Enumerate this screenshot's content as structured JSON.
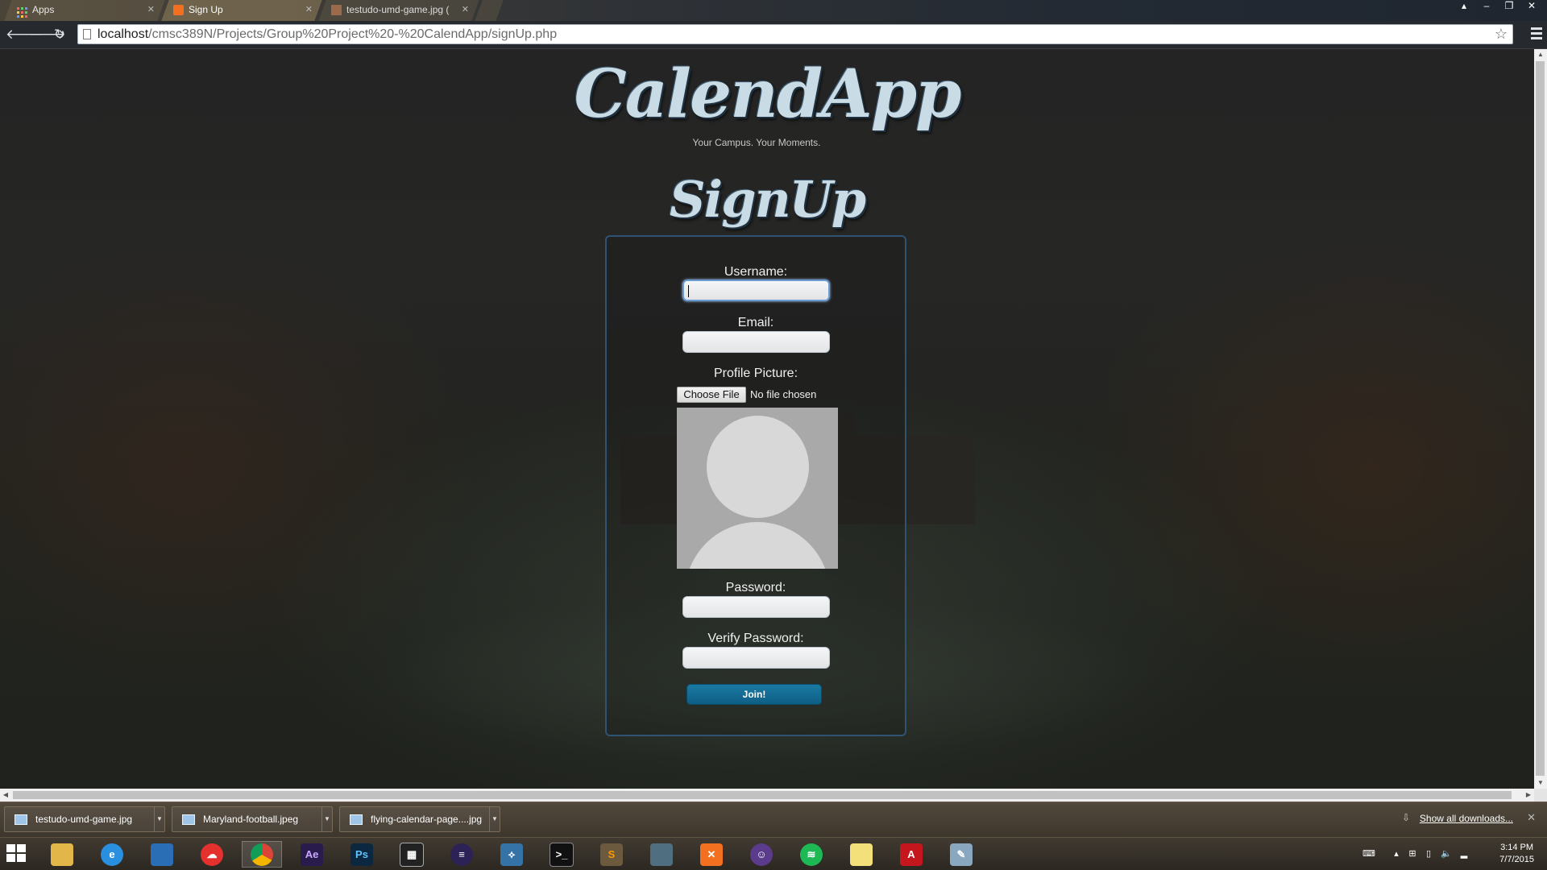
{
  "browser": {
    "tabs": [
      {
        "label": "Apps",
        "active": false
      },
      {
        "label": "Sign Up",
        "active": true
      },
      {
        "label": "testudo-umd-game.jpg (",
        "active": false
      }
    ],
    "url_host": "localhost",
    "url_path": "/cmsc389N/Projects/Group%20Project%20-%20CalendApp/signUp.php"
  },
  "page": {
    "logo": "CalendApp",
    "tagline": "Your Campus. Your Moments.",
    "title": "SignUp",
    "form": {
      "username_label": "Username:",
      "username_value": "",
      "email_label": "Email:",
      "email_value": "",
      "profile_label": "Profile Picture:",
      "choose_file": "Choose File",
      "file_status": "No file chosen",
      "password_label": "Password:",
      "verify_label": "Verify Password:",
      "join_label": "Join!"
    }
  },
  "downloads": {
    "items": [
      "testudo-umd-game.jpg",
      "Maryland-football.jpeg",
      "flying-calendar-page....jpg"
    ],
    "show_all": "Show all downloads..."
  },
  "taskbar": {
    "apps": [
      "file-explorer",
      "internet-explorer",
      "remote-desktop",
      "cloud-app",
      "chrome",
      "after-effects",
      "photoshop",
      "media-player",
      "eclipse",
      "python",
      "terminal",
      "sublime-text",
      "network-app",
      "xampp",
      "github",
      "spotify",
      "sticky-notes",
      "acrobat",
      "paint"
    ],
    "time": "3:14 PM",
    "date": "7/7/2015"
  },
  "colors": {
    "join_button": "#0e5e84",
    "form_border": "#2f5373",
    "logo_fill": "#c9dbe5"
  }
}
